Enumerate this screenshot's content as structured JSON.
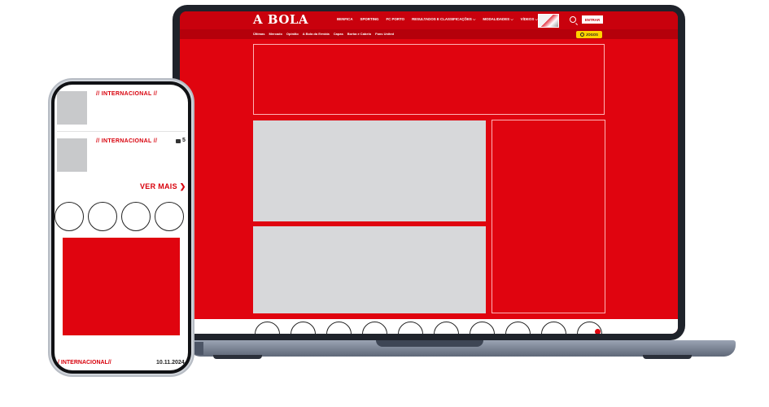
{
  "laptop_site": {
    "logo": "A BOLA",
    "nav": {
      "benfica": "BENFICA",
      "sporting": "SPORTING",
      "fcporto": "FC PORTO",
      "resultados": "RESULTADOS E CLASSIFICAÇÕES",
      "modalidades": "MODALIDADES",
      "videos": "VÍDEOS"
    },
    "chevron": "⌵",
    "login_label": "ENTRAR",
    "subnav": {
      "ultimas": "Últimas",
      "mercado": "Mercado",
      "opiniao": "Opinião",
      "abola_ermida": "A Bola da Ermida",
      "capas": "Capas",
      "borba": "Borba e Cabelo",
      "fans": "Fans United"
    },
    "jogos_label": "JOGOS",
    "icons": [
      "search-icon",
      "jogos-icon"
    ],
    "colors": {
      "brand_red": "#e0040f",
      "header_red": "#c9010d",
      "jogos_yellow": "#ffd200"
    }
  },
  "phone_site": {
    "tag_1": "// INTERNACIONAL //",
    "tag_2": "// INTERNACIONAL //",
    "comment_count": "5",
    "ver_mais": "VER MAIS ❯",
    "bottom_tag": "/ INTERNACIONAL//",
    "bottom_date": "10.11.2024"
  }
}
